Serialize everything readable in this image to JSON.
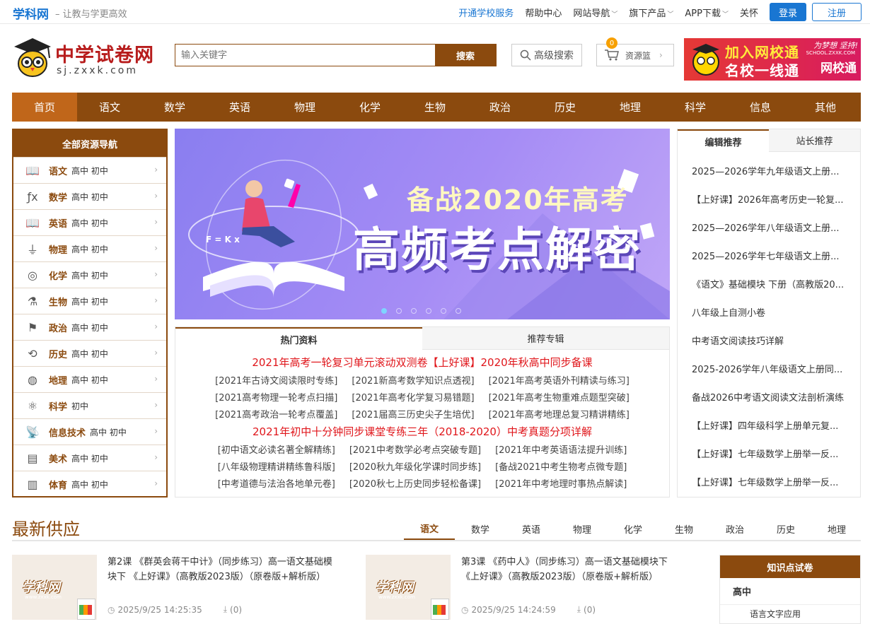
{
  "topbar": {
    "brand": "学科网",
    "slogan": "让教与学更高效",
    "links": [
      {
        "label": "开通学校服务",
        "blue": true,
        "caret": false
      },
      {
        "label": "帮助中心",
        "blue": false,
        "caret": false
      },
      {
        "label": "网站导航",
        "blue": false,
        "caret": true
      },
      {
        "label": "旗下产品",
        "blue": false,
        "caret": true
      },
      {
        "label": "APP下载",
        "blue": false,
        "caret": true
      },
      {
        "label": "关怀",
        "blue": false,
        "caret": false
      }
    ],
    "login": "登录",
    "register": "注册"
  },
  "header": {
    "logo_title": "中学试卷网",
    "logo_url": "sj.zxxk.com",
    "search_placeholder": "输入关键字",
    "search_button": "搜索",
    "advanced_search": "高级搜索",
    "basket_label": "资源篮",
    "basket_count": "0"
  },
  "ad": {
    "line1": "加入网校通",
    "line2": "名校一线通",
    "brand": "网校通",
    "slogan": "为梦想 坚持!",
    "url": "SCHOOL.ZXXK.COM"
  },
  "mainnav": [
    "首页",
    "语文",
    "数学",
    "英语",
    "物理",
    "化学",
    "生物",
    "政治",
    "历史",
    "地理",
    "科学",
    "信息",
    "其他"
  ],
  "sidenav": {
    "title": "全部资源导航",
    "items": [
      {
        "name": "语文",
        "sub": "高中  初中",
        "icon": "book-icon"
      },
      {
        "name": "数学",
        "sub": "高中  初中",
        "icon": "function-icon"
      },
      {
        "name": "英语",
        "sub": "高中  初中",
        "icon": "book-icon"
      },
      {
        "name": "物理",
        "sub": "高中  初中",
        "icon": "plug-icon"
      },
      {
        "name": "化学",
        "sub": "高中  初中",
        "icon": "flask-icon"
      },
      {
        "name": "生物",
        "sub": "高中  初中",
        "icon": "microscope-icon"
      },
      {
        "name": "政治",
        "sub": "高中  初中",
        "icon": "flag-icon"
      },
      {
        "name": "历史",
        "sub": "高中  初中",
        "icon": "history-icon"
      },
      {
        "name": "地理",
        "sub": "高中  初中",
        "icon": "globe-icon"
      },
      {
        "name": "科学",
        "sub": "初中",
        "icon": "atom-icon"
      },
      {
        "name": "信息技术",
        "sub": "高中  初中",
        "icon": "satellite-icon"
      },
      {
        "name": "美术",
        "sub": "高中  初中",
        "icon": "layers-icon"
      },
      {
        "name": "体育",
        "sub": "高中  初中",
        "icon": "map-icon"
      }
    ]
  },
  "banner": {
    "line1": "备战2020年高考",
    "line2": "高频考点解密",
    "formula": "F = K x"
  },
  "hotbox": {
    "tabs": [
      "热门资料",
      "推荐专辑"
    ],
    "red1": [
      "2021年高考一轮复习单元滚动双测卷",
      "【上好课】2020年秋高中同步备课"
    ],
    "rows1": [
      [
        "[2021年古诗文阅读限时专练]",
        "[2021新高考数学知识点透视]",
        "[2021年高考英语外刊精读与练习]"
      ],
      [
        "[2021高考物理一轮考点扫描]",
        "[2021年高考化学复习易错题]",
        "[2021年高考生物重难点题型突破]"
      ],
      [
        "[2021高考政治一轮考点覆盖]",
        "[2021届高三历史尖子生培优]",
        "[2021年高考地理总复习精讲精练]"
      ]
    ],
    "red2": [
      "2021年初中十分钟同步课堂专练",
      "三年（2018-2020）中考真题分项详解"
    ],
    "rows2": [
      [
        "[初中语文必读名著全解精练]",
        "[2021中考数学必考点突破专题]",
        "[2021年中考英语语法提升训练]"
      ],
      [
        "[八年级物理精讲精练鲁科版]",
        "[2020秋九年级化学课时同步练]",
        "[备战2021中考生物考点微专题]"
      ],
      [
        "[中考道德与法治各地单元卷]",
        "[2020秋七上历史同步轻松备课]",
        "[2021年中考地理时事热点解读]"
      ]
    ]
  },
  "rpanel": {
    "tabs": [
      "编辑推荐",
      "站长推荐"
    ],
    "items": [
      "2025—2026学年九年级语文上册...",
      "【上好课】2026年高考历史一轮复...",
      "2025—2026学年八年级语文上册...",
      "2025—2026学年七年级语文上册...",
      "《语文》基础模块 下册（高教版20...",
      "八年级上自测小卷",
      "中考语文阅读技巧详解",
      "2025-2026学年八年级语文上册同...",
      "备战2026中考语文阅读文法剖析演练",
      "【上好课】四年级科学上册单元复...",
      "【上好课】七年级数学上册举一反...",
      "【上好课】七年级数学上册举一反..."
    ]
  },
  "latest": {
    "title": "最新供应",
    "tabs": [
      "语文",
      "数学",
      "英语",
      "物理",
      "化学",
      "生物",
      "政治",
      "历史",
      "地理"
    ],
    "thumb_word": "学科网",
    "thumb_url": "www.zxxk.com",
    "cards": [
      {
        "title": "第2课 《群英会蒋干中计》（同步练习）高一语文基础模块下 《上好课》（高教版2023版）（原卷版+解析版）",
        "time": "2025/9/25 14:25:35",
        "downloads": "(0)"
      },
      {
        "title": "第3课 《药中人》（同步练习）高一语文基础模块下 《上好课》（高教版2023版）（原卷版+解析版）",
        "time": "2025/9/25 14:24:59",
        "downloads": "(0)"
      }
    ],
    "kp_title": "知识点试卷",
    "kp_level": "高中",
    "kp_sub": "语言文字应用"
  }
}
